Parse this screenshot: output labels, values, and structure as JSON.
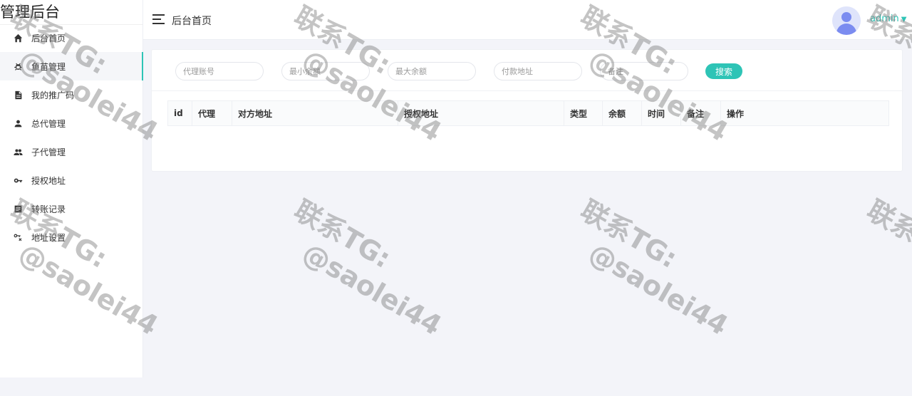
{
  "brand": "管理后台",
  "sidebar": {
    "items": [
      {
        "label": "后台首页",
        "icon": "home-icon"
      },
      {
        "label": "鱼苗管理",
        "icon": "bug-icon"
      },
      {
        "label": "我的推广码",
        "icon": "document-icon"
      },
      {
        "label": "总代管理",
        "icon": "user-icon"
      },
      {
        "label": "子代管理",
        "icon": "group-icon"
      },
      {
        "label": "授权地址",
        "icon": "key-icon"
      },
      {
        "label": "转账记录",
        "icon": "list-icon"
      },
      {
        "label": "地址设置",
        "icon": "key-settings-icon"
      }
    ],
    "active_index": 1
  },
  "header": {
    "title": "后台首页",
    "user": "admin"
  },
  "filters": {
    "agent_account_placeholder": "代理账号",
    "min_balance_placeholder": "最小余额",
    "max_balance_placeholder": "最大余额",
    "pay_address_placeholder": "付款地址",
    "remark_placeholder": "备注",
    "search_label": "搜索"
  },
  "table": {
    "columns": [
      "id",
      "代理",
      "对方地址",
      "授权地址",
      "类型",
      "余额",
      "时间",
      "备注",
      "操作"
    ]
  },
  "watermark": {
    "line1": "联系TG:",
    "line2": "@saolei44"
  },
  "colors": {
    "accent": "#2ec4b6",
    "background": "#f3f4f9"
  }
}
